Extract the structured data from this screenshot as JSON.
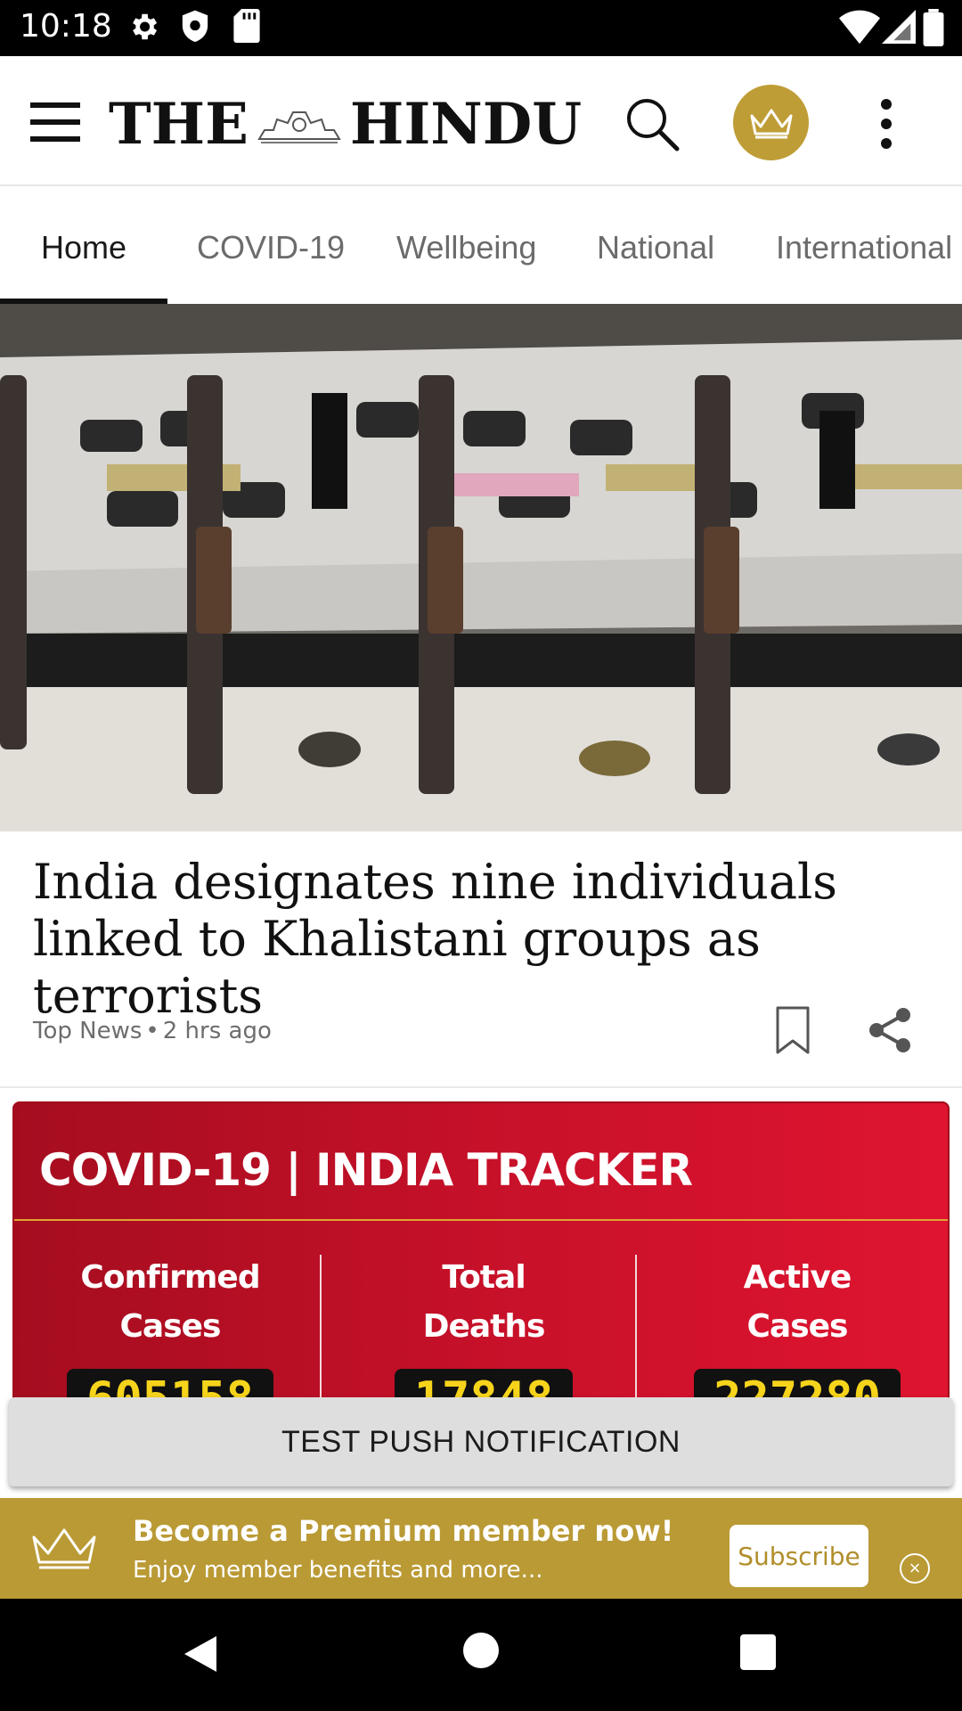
{
  "status_bar": {
    "time": "10:18"
  },
  "header": {
    "logo_left": "THE",
    "logo_right": "HINDU"
  },
  "tabs": [
    {
      "label": "Home",
      "active": true
    },
    {
      "label": "COVID-19"
    },
    {
      "label": "Wellbeing"
    },
    {
      "label": "National"
    },
    {
      "label": "International"
    }
  ],
  "article": {
    "headline": "India designates nine individuals linked to Khalistani groups as terrorists",
    "section": "Top News",
    "age": "2 hrs ago"
  },
  "tracker": {
    "title": "COVID-19 | INDIA TRACKER",
    "stats": [
      {
        "label_line1": "Confirmed",
        "label_line2": "Cases",
        "value": "605158"
      },
      {
        "label_line1": "Total",
        "label_line2": "Deaths",
        "value": "17848"
      },
      {
        "label_line1": "Active",
        "label_line2": "Cases",
        "value": "227280"
      }
    ]
  },
  "push_button": {
    "label": "TEST PUSH NOTIFICATION"
  },
  "premium_banner": {
    "title": "Become a Premium member now!",
    "subtitle": "Enjoy member benefits and more...",
    "subscribe_label": "Subscribe",
    "close_glyph": "×",
    "accent": "#ba9a35"
  },
  "colors": {
    "tracker_red": "#c9112a",
    "tracker_value": "#f6d41b"
  }
}
